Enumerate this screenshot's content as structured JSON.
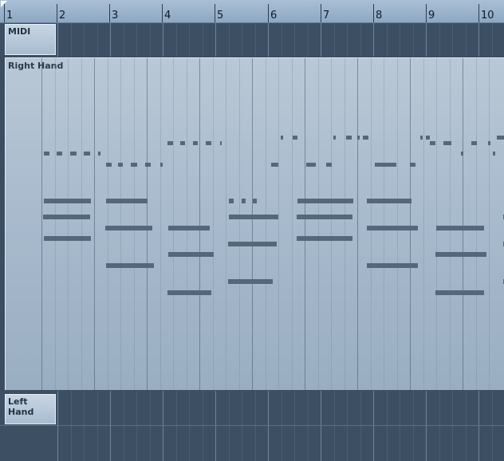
{
  "ruler": {
    "bars": [
      "1",
      "2",
      "3",
      "4",
      "5",
      "6",
      "7",
      "8",
      "9",
      "10"
    ]
  },
  "tracks": {
    "midi": {
      "label": "MIDI"
    },
    "right_hand": {
      "label": "Right Hand"
    },
    "left_hand": {
      "label": "Left Hand"
    }
  },
  "colors": {
    "ruler": "#8ea8c2",
    "track_background": "#3d4f63",
    "part_background": "#aabcce",
    "note": "#55677a"
  }
}
